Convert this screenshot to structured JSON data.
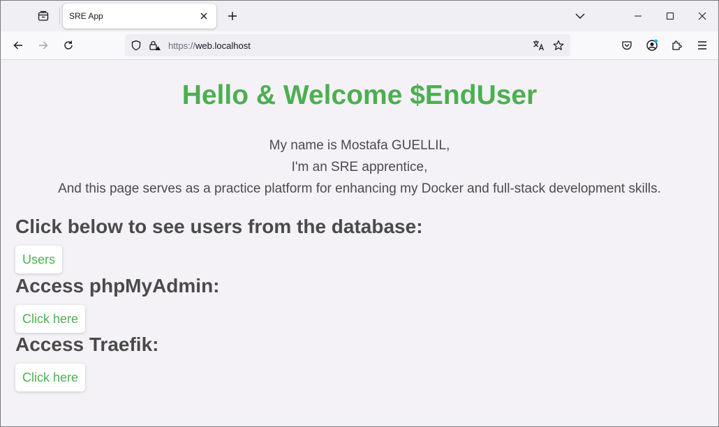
{
  "browser": {
    "tab": {
      "title": "SRE App"
    },
    "url": {
      "scheme": "https://",
      "host": "web.localhost"
    },
    "icons": {
      "tab_list": "firefox-view-icon",
      "tab_close": "close-icon",
      "new_tab": "plus-icon",
      "list_tabs": "chevron-down-icon",
      "minimize": "minimize-icon",
      "maximize": "maximize-icon",
      "close_window": "close-icon",
      "back": "back-arrow-icon",
      "forward": "forward-arrow-icon",
      "reload": "reload-icon",
      "tracking": "shield-icon",
      "site_info": "lock-warning-icon",
      "translate": "translate-icon",
      "bookmark": "star-icon",
      "pocket": "pocket-icon",
      "account": "account-icon",
      "extensions": "puzzle-icon",
      "menu": "hamburger-menu-icon"
    }
  },
  "page": {
    "headline": "Hello & Welcome $EndUser",
    "intro": [
      "My name is Mostafa GUELLIL,",
      "I'm an SRE apprentice,",
      "And this page serves as a practice platform for enhancing my Docker and full-stack development skills."
    ],
    "sections": [
      {
        "heading": "Click below to see users from the database:",
        "button": "Users"
      },
      {
        "heading": "Access phpMyAdmin:",
        "button": "Click here"
      },
      {
        "heading": "Access Traefik:",
        "button": "Click here"
      }
    ]
  },
  "colors": {
    "accent_green": "#4caf50",
    "text_gray": "#4a4a4a",
    "page_bg": "#f4f2f7",
    "account_dot": "#00b3f4"
  }
}
